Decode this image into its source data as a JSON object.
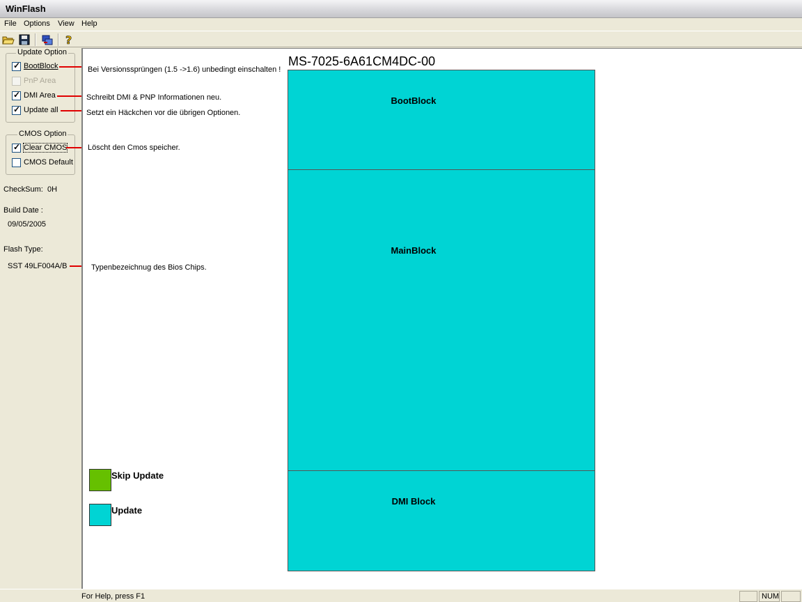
{
  "window": {
    "title": "WinFlash"
  },
  "menu": [
    "File",
    "Options",
    "View",
    "Help"
  ],
  "toolbar": {
    "icons": [
      "open-folder-icon",
      "save-disk-icon",
      "flash-chip-icon",
      "help-icon"
    ]
  },
  "update_option": {
    "legend": "Update Option",
    "items": [
      {
        "label": "BootBlock",
        "checked": true,
        "enabled": true
      },
      {
        "label": "PnP Area",
        "checked": false,
        "enabled": false
      },
      {
        "label": "DMI Area",
        "checked": true,
        "enabled": true
      },
      {
        "label": "Update all",
        "checked": true,
        "enabled": true
      }
    ]
  },
  "cmos_option": {
    "legend": "CMOS Option",
    "items": [
      {
        "label": "Clear CMOS",
        "checked": true
      },
      {
        "label": "CMOS Default",
        "checked": false
      }
    ]
  },
  "info": {
    "checksum_label": "CheckSum:",
    "checksum_value": "0H",
    "build_date_label": "Build Date :",
    "build_date_value": "09/05/2005",
    "flash_type_label": "Flash Type:",
    "flash_type_value": "SST 49LF004A/B"
  },
  "annotations": {
    "bootblock": "Bei Versionssprüngen (1.5 ->1.6) unbedingt einschalten !",
    "dmi": "Schreibt DMI & PNP Informationen neu.",
    "update_all": "Setzt ein Häckchen vor die übrigen Optionen.",
    "clear_cmos": "Löscht den Cmos speicher.",
    "flash_type": "Typenbezeichnug des Bios Chips."
  },
  "chip": {
    "name": "MS-7025-6A61CM4DC-00",
    "blocks": [
      {
        "label": "BootBlock",
        "color": "#00d4d4"
      },
      {
        "label": "MainBlock",
        "color": "#00d4d4"
      },
      {
        "label": "DMI Block",
        "color": "#00d4d4"
      }
    ]
  },
  "legend": [
    {
      "label": "Skip Update",
      "color": "#66c000"
    },
    {
      "label": "Update",
      "color": "#00d4d4"
    }
  ],
  "status": {
    "text": "For Help, press F1",
    "num": "NUM"
  }
}
